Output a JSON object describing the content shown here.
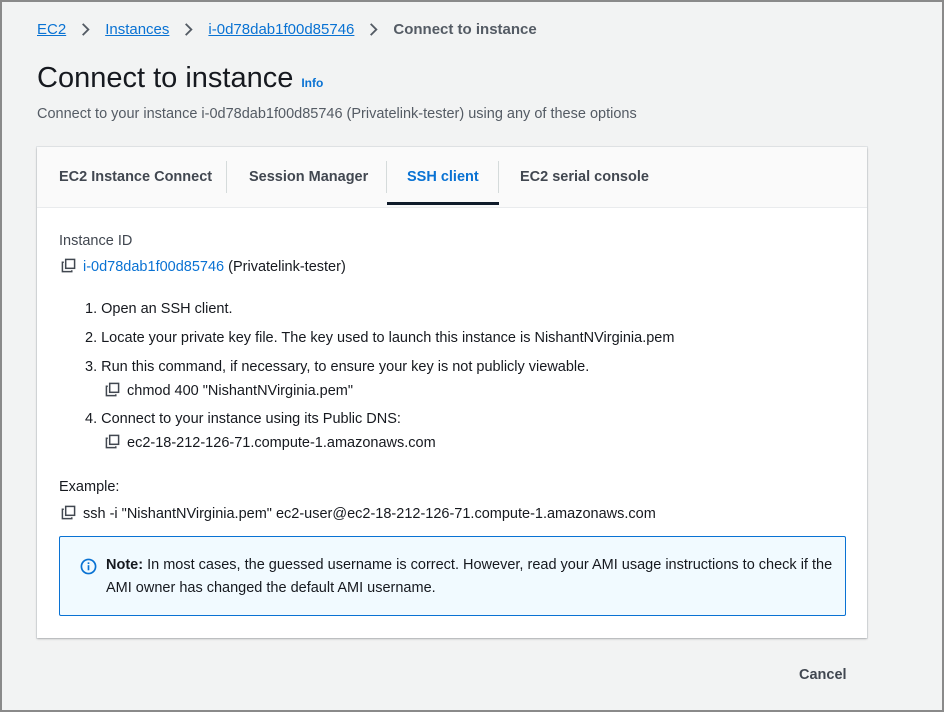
{
  "breadcrumb": {
    "items": [
      "EC2",
      "Instances",
      "i-0d78dab1f00d85746"
    ],
    "current": "Connect to instance"
  },
  "header": {
    "title": "Connect to instance",
    "info_label": "Info",
    "subtitle": "Connect to your instance i-0d78dab1f00d85746 (Privatelink-tester) using any of these options"
  },
  "tabs": [
    {
      "label": "EC2 Instance Connect",
      "active": false
    },
    {
      "label": "Session Manager",
      "active": false
    },
    {
      "label": "SSH client",
      "active": true
    },
    {
      "label": "EC2 serial console",
      "active": false
    }
  ],
  "instance": {
    "label": "Instance ID",
    "id": "i-0d78dab1f00d85746",
    "name": "(Privatelink-tester)"
  },
  "steps": [
    "1. Open an SSH client.",
    "2. Locate your private key file. The key used to launch this instance is NishantNVirginia.pem",
    "3. Run this command, if necessary, to ensure your key is not publicly viewable.",
    "4. Connect to your instance using its Public DNS:"
  ],
  "commands": {
    "chmod": "chmod 400 \"NishantNVirginia.pem\"",
    "dns": "ec2-18-212-126-71.compute-1.amazonaws.com"
  },
  "example": {
    "label": "Example:",
    "command": "ssh -i \"NishantNVirginia.pem\" ec2-user@ec2-18-212-126-71.compute-1.amazonaws.com"
  },
  "note": {
    "title": "Note:",
    "text": "In most cases, the guessed username is correct. However, read your AMI usage instructions to check if the AMI owner has changed the default AMI username."
  },
  "footer": {
    "cancel_label": "Cancel"
  },
  "colors": {
    "link": "#0972d3",
    "active_tab_underline": "#0f1b2a",
    "note_background": "#f1faff"
  }
}
